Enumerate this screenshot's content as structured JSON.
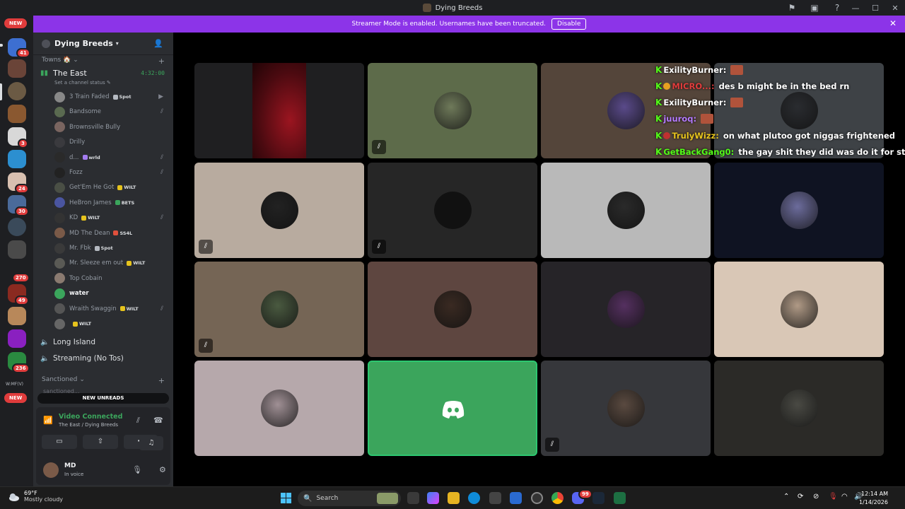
{
  "window": {
    "title": "Dying Breeds",
    "controls": [
      "—",
      "☐",
      "✕"
    ]
  },
  "banner": {
    "text": "Streamer Mode is enabled. Usernames have been truncated.",
    "button": "Disable"
  },
  "rail": {
    "new_top": "NEW",
    "new_bottom": "NEW",
    "badges": [
      "41",
      "3",
      "24",
      "30",
      "270",
      "49",
      "236"
    ],
    "wmf_label": "W:MF(V)"
  },
  "server": {
    "name": "Dying Breeds",
    "category1": "Towns 🏠",
    "category2": "Sanctioned",
    "channel_partial": "sanctioned..."
  },
  "voice_channel": {
    "name": "The East",
    "timer": "4:32:00",
    "status_prompt": "Set a channel status ✎",
    "members": [
      {
        "name": "3 Train Faded",
        "tag": "Spot",
        "tag_color": "#b5bac1",
        "icon": "video",
        "av": "#888"
      },
      {
        "name": "Bandsome",
        "tag": "",
        "tag_color": "",
        "icon": "muted",
        "av": "#5a6a50"
      },
      {
        "name": "Brownsville Bully",
        "tag": "",
        "tag_color": "",
        "icon": "",
        "av": "#7a6560"
      },
      {
        "name": "Drilly",
        "tag": "",
        "tag_color": "",
        "icon": "",
        "av": "#3a3a3e"
      },
      {
        "name": "d...",
        "tag": "wrld",
        "tag_color": "#a37cf0",
        "icon": "muted",
        "av": "#2a2a2a"
      },
      {
        "name": "Fozz",
        "tag": "",
        "tag_color": "",
        "icon": "muted",
        "av": "#222"
      },
      {
        "name": "Get'Em He Got",
        "tag": "WILT",
        "tag_color": "#e6c31d",
        "icon": "",
        "av": "#4a4f45"
      },
      {
        "name": "HeBron James",
        "tag": "BETS",
        "tag_color": "#3ba55c",
        "icon": "",
        "av": "#4a55a0"
      },
      {
        "name": "KD",
        "tag": "WILT",
        "tag_color": "#e6c31d",
        "icon": "muted",
        "av": "#333"
      },
      {
        "name": "MD The Dean",
        "tag": "SS4L",
        "tag_color": "#e0503c",
        "icon": "",
        "av": "#7a5a48"
      },
      {
        "name": "Mr. Fbk",
        "tag": "Spot",
        "tag_color": "#b5bac1",
        "icon": "",
        "av": "#3a3a3a"
      },
      {
        "name": "Mr. Sleeze em out",
        "tag": "WILT",
        "tag_color": "#e6c31d",
        "icon": "",
        "av": "#5a5a55"
      },
      {
        "name": "Top Cobain",
        "tag": "",
        "tag_color": "",
        "icon": "",
        "av": "#8a7a70"
      },
      {
        "name": "water",
        "tag": "",
        "tag_color": "",
        "icon": "",
        "av": "#3ba55c"
      },
      {
        "name": "Wraith Swaggin",
        "tag": "WILT",
        "tag_color": "#e6c31d",
        "icon": "muted",
        "av": "#555"
      },
      {
        "name": "",
        "tag": "WILT",
        "tag_color": "#e6c31d",
        "icon": "",
        "av": "#666"
      }
    ]
  },
  "other_channels": [
    "Long Island",
    "Streaming (No Tos)"
  ],
  "new_unreads": "NEW UNREADS",
  "voice_panel": {
    "status": "Video Connected",
    "location": "The East / Dying Breeds",
    "user": "MD",
    "user_status": "In voice"
  },
  "tiles": [
    {
      "bg": "#1f1f21",
      "type": "red",
      "av": "",
      "muted": false
    },
    {
      "bg": "#5d6b4a",
      "type": "avatar",
      "av": "#6f7a5a",
      "muted": true
    },
    {
      "bg": "#54453a",
      "type": "avatar",
      "av": "#5a4a8a",
      "muted": false
    },
    {
      "bg": "#3e4246",
      "type": "avatar",
      "av": "#2a2c30",
      "muted": false
    },
    {
      "bg": "#b8ab9f",
      "type": "avatar",
      "av": "#222",
      "muted": true
    },
    {
      "bg": "#262626",
      "type": "avatar",
      "av": "#111",
      "muted": true
    },
    {
      "bg": "#b9b9b9",
      "type": "avatar",
      "av": "#2a2a2a",
      "muted": false
    },
    {
      "bg": "#0f1322",
      "type": "avatar",
      "av": "#6c6c9c",
      "muted": false
    },
    {
      "bg": "#756555",
      "type": "avatar",
      "av": "#4a5a40",
      "muted": true
    },
    {
      "bg": "#5e4640",
      "type": "avatar",
      "av": "#3a2a22",
      "muted": false
    },
    {
      "bg": "#262428",
      "type": "avatar",
      "av": "#553060",
      "muted": false
    },
    {
      "bg": "#d9c7b6",
      "type": "avatar",
      "av": "#b09a86",
      "muted": false
    },
    {
      "bg": "#b6a8ab",
      "type": "avatar",
      "av": "#a09095",
      "muted": false
    },
    {
      "bg": "#3ba55c",
      "type": "discord",
      "av": "",
      "muted": false
    },
    {
      "bg": "#36373b",
      "type": "avatar",
      "av": "#5a4a40",
      "muted": true
    },
    {
      "bg": "#2b2a27",
      "type": "avatar",
      "av": "#4a4a44",
      "muted": false
    }
  ],
  "chat": [
    {
      "user": "ExilityBurner",
      "user_color": "#fff",
      "text": "",
      "emote": true,
      "badge": ""
    },
    {
      "user": "MICRO...",
      "user_color": "#e03c3c",
      "text": "des b might be in the bed rn",
      "emote": false,
      "badge": "#e6a020"
    },
    {
      "user": "ExilityBurner",
      "user_color": "#fff",
      "text": "",
      "emote": true,
      "badge": ""
    },
    {
      "user": "juuroq",
      "user_color": "#b57bff",
      "text": "",
      "emote": true,
      "badge": ""
    },
    {
      "user": "TrulyWizz",
      "user_color": "#e6c31d",
      "text": "on what plutoo got niggas frightened",
      "emote": false,
      "badge": "#c03030"
    },
    {
      "user": "GetBackGang0",
      "user_color": "#53fc18",
      "text": "the gay shit they did was do it for stream t",
      "emote": false,
      "badge": ""
    }
  ],
  "taskbar": {
    "temp": "69°F",
    "condition": "Mostly cloudy",
    "search": "Search",
    "time": "12:14 AM",
    "date": "1/14/2026",
    "notif": "99"
  }
}
